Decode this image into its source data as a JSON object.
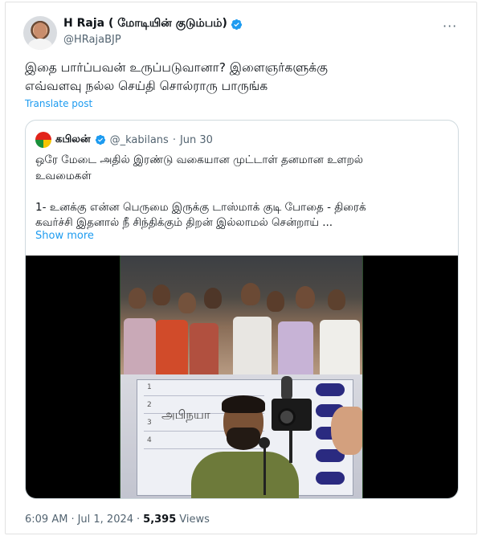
{
  "author": {
    "display_name": "H Raja ( மோடியின் குடும்பம்)",
    "handle": "@HRajaBJP",
    "verified_icon": "verified-badge-icon"
  },
  "tweet": {
    "text": "இதை பார்ப்பவன் உருப்படுவானா? இளைஞர்களுக்கு\nஎவ்வளவு நல்ல செய்தி சொல்ராரு பாருங்க",
    "translate_label": "Translate post",
    "more_label": "···"
  },
  "quoted": {
    "display_name": "கபிலன்",
    "handle": "@_kabilans",
    "separator": "·",
    "date": "Jun 30",
    "text": "ஒரே மேடை அதில் இரண்டு வகையான முட்டாள் தனமான உளறல்\nஉவமைகள்\n\n1- உனக்கு என்ன பெருமை இருக்கு டாஸ்மாக் குடி போதை - திரைக்\nகவர்ச்சி இதனால் நீ சிந்திக்கும் திறன் இல்லாமல் சென்றாய் ...",
    "show_more_label": "Show more",
    "board_text": "அபிநயா",
    "board_numbers": [
      "1",
      "2",
      "3",
      "4"
    ]
  },
  "footer": {
    "time": "6:09 AM",
    "dot": "·",
    "date": "Jul 1, 2024",
    "dot2": "·",
    "views_count": "5,395",
    "views_label": "Views"
  },
  "colors": {
    "accent": "#1d9bf0",
    "text": "#0f1419",
    "muted": "#536471",
    "border": "#cfd9de"
  }
}
